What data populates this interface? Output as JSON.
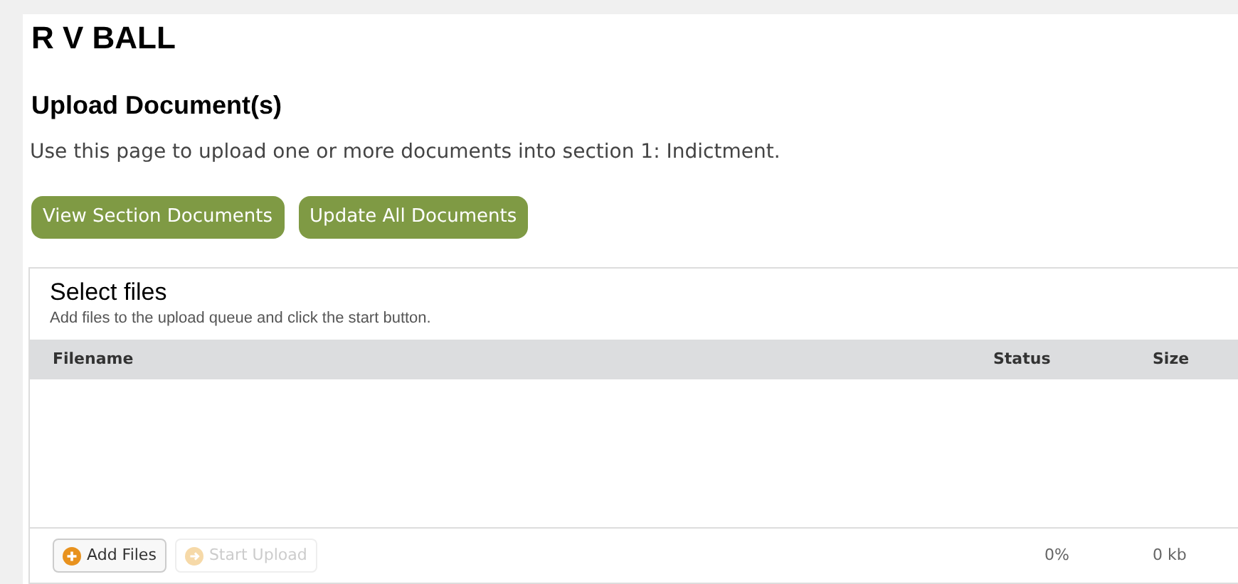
{
  "case_title": "R V BALL",
  "page_heading": "Upload Document(s)",
  "intro": "Use this page to upload one or more documents into section 1: Indictment.",
  "actions": [
    {
      "label": "View Section Documents"
    },
    {
      "label": "Update All Documents"
    }
  ],
  "uploader": {
    "title": "Select files",
    "hint": "Add files to the upload queue and click the start button.",
    "columns": [
      "Filename",
      "Status",
      "Size"
    ],
    "buttons": [
      {
        "label": "Add Files",
        "disabled": false
      },
      {
        "label": "Start Upload",
        "disabled": true
      }
    ],
    "total_percent": "0%",
    "total_size": "0 kb"
  }
}
